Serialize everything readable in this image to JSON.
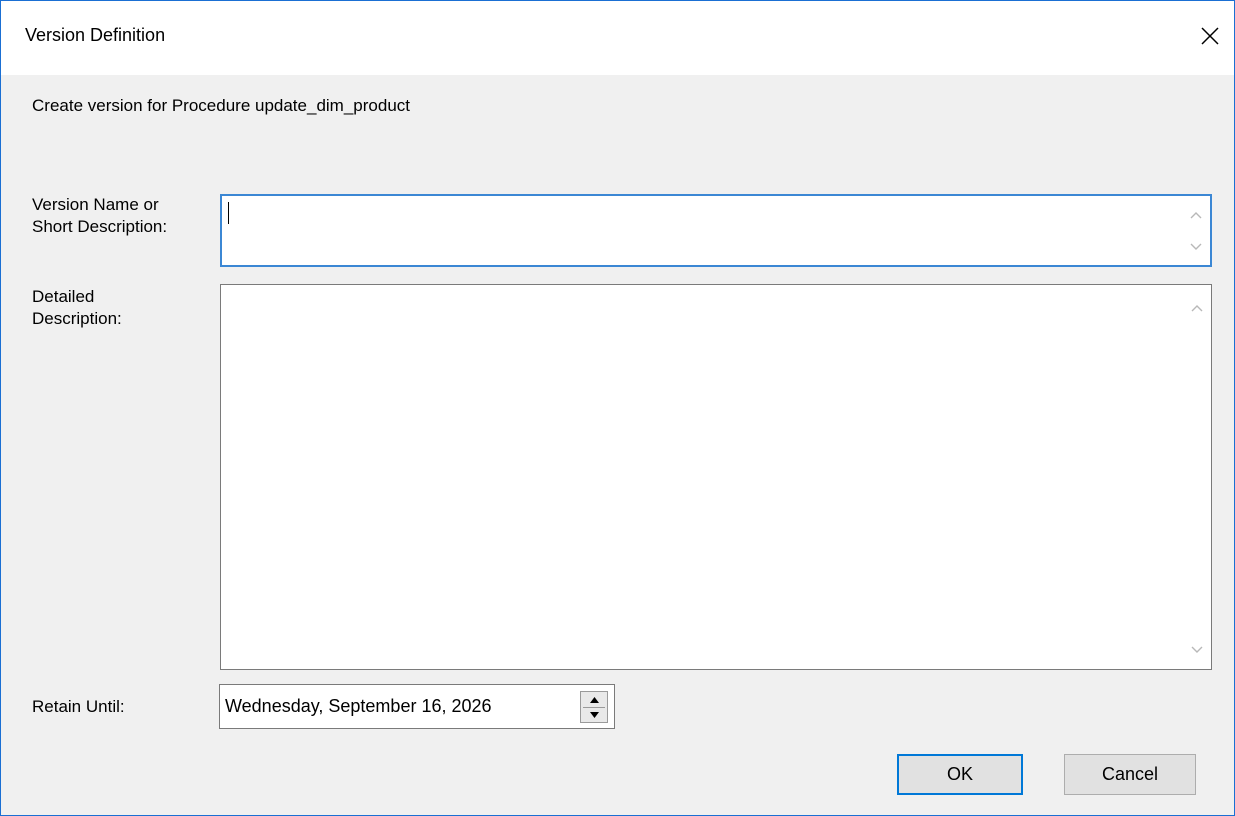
{
  "window": {
    "title": "Version Definition",
    "close_icon": "close-icon"
  },
  "dialog": {
    "header": "Create version for Procedure update_dim_product",
    "version_name_label": "Version Name or\nShort Description:",
    "version_name_value": "",
    "detailed_description_label": "Detailed\nDescription:",
    "detailed_description_value": "",
    "retain_until_label": "Retain Until:",
    "retain_until_value": "Wednesday, September 16, 2026"
  },
  "buttons": {
    "ok_label": "OK",
    "cancel_label": "Cancel"
  },
  "colors": {
    "window_border": "#1a6fd3",
    "focus_border": "#3b87d4",
    "default_button_border": "#0078d7",
    "button_face": "#e1e1e1",
    "dialog_background": "#f0f0f0"
  }
}
